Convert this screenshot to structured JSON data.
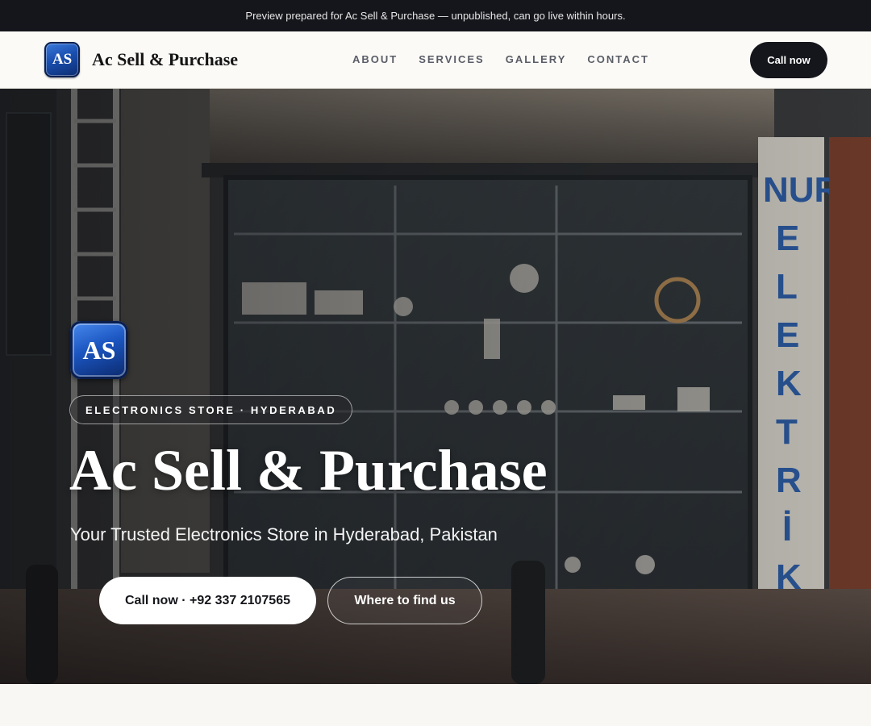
{
  "announcement": "Preview prepared for Ac Sell & Purchase — unpublished, can go live within hours.",
  "brand": {
    "logo_text": "AS",
    "name": "Ac Sell & Purchase",
    "logo_color": "#1a4fb0"
  },
  "nav": {
    "links": [
      "ABOUT",
      "SERVICES",
      "GALLERY",
      "CONTACT"
    ],
    "cta_label": "Call now"
  },
  "hero": {
    "logo_text": "AS",
    "badge": "ELECTRONICS STORE · HYDERABAD",
    "title": "Ac Sell & Purchase",
    "subtitle": "Your Trusted Electronics Store in Hyderabad, Pakistan",
    "primary_button": "Call now · +92 337 2107565",
    "secondary_button": "Where to find us",
    "background_image": "electronics shop storefront",
    "sign_letters": [
      "NUR",
      "E",
      "L",
      "E",
      "K",
      "T",
      "R",
      "İ",
      "K"
    ]
  },
  "colors": {
    "dark": "#15161b",
    "page_bg": "#f8f7f3",
    "nav_text": "#5a5d66"
  }
}
